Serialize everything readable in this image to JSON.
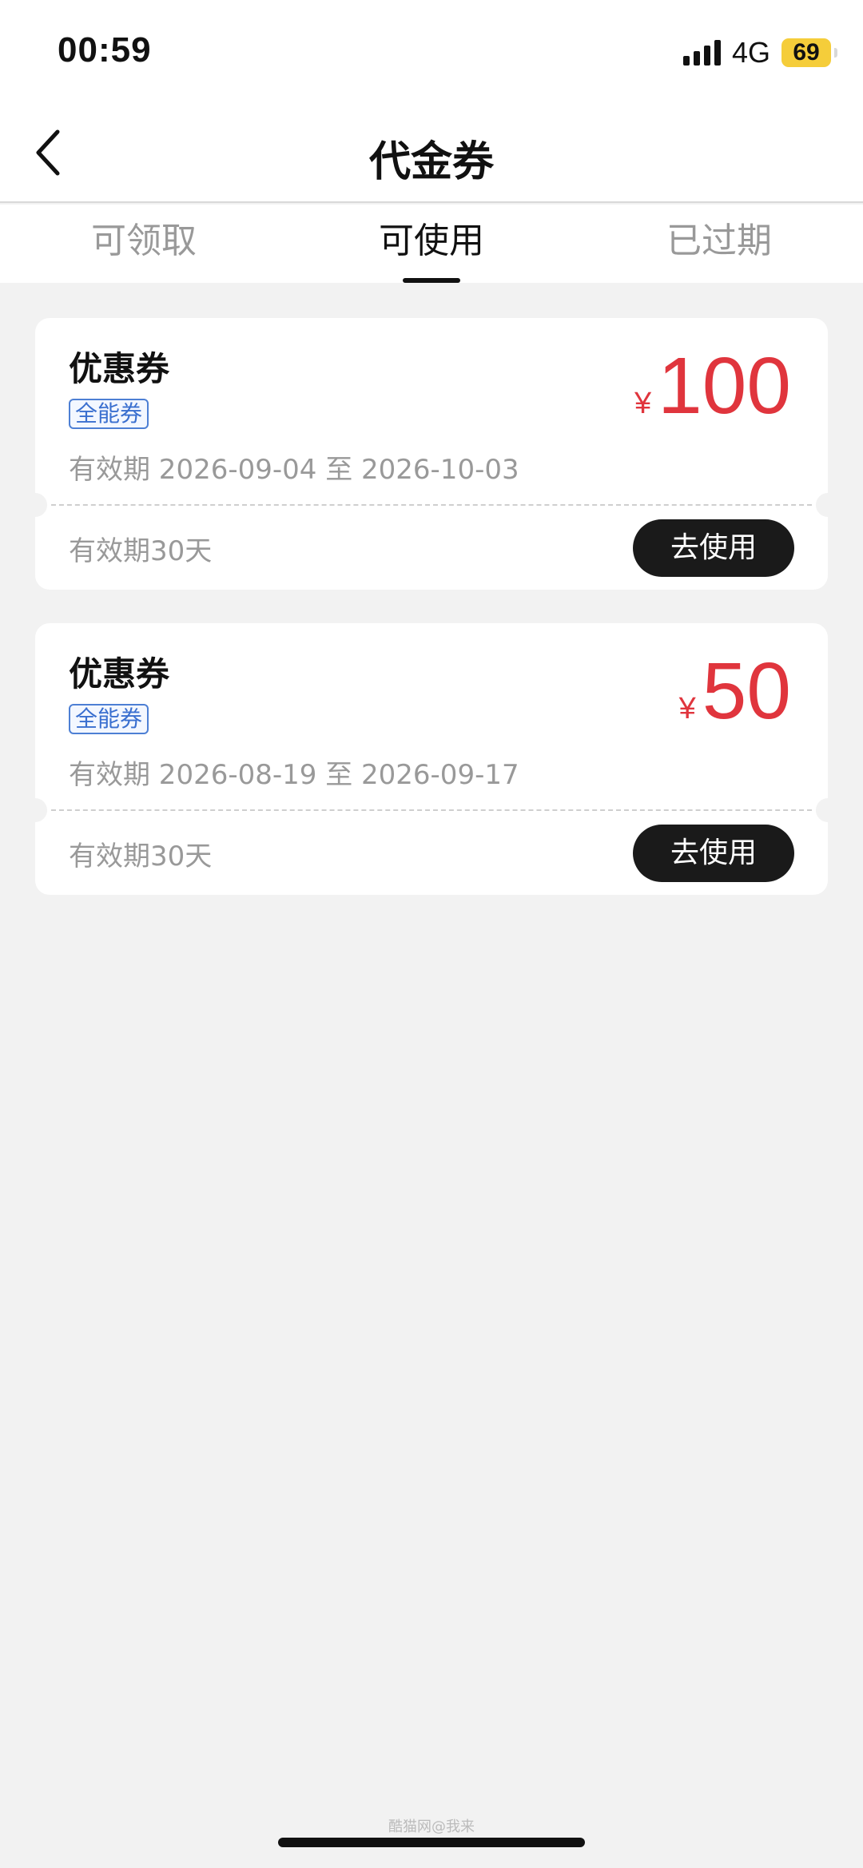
{
  "status_bar": {
    "time": "00:59",
    "network": "4G",
    "battery": "69",
    "signal_icon": "signal-bars-icon",
    "battery_color": "#f5cd3a"
  },
  "nav": {
    "title": "代金券",
    "back_icon": "chevron-left-icon"
  },
  "tabs": [
    {
      "label": "可领取",
      "active": false
    },
    {
      "label": "可使用",
      "active": true
    },
    {
      "label": "已过期",
      "active": false
    }
  ],
  "coupons": [
    {
      "title": "优惠券",
      "tag": "全能券",
      "currency": "¥",
      "amount": "100",
      "validity": "有效期 2026-09-04 至 2026-10-03",
      "duration": "有效期30天",
      "button": "去使用"
    },
    {
      "title": "优惠券",
      "tag": "全能券",
      "currency": "¥",
      "amount": "50",
      "validity": "有效期 2026-08-19 至 2026-09-17",
      "duration": "有效期30天",
      "button": "去使用"
    }
  ],
  "colors": {
    "accent_red": "#e0353d",
    "tag_blue": "#3a6fcf",
    "button_dark": "#1a1a1a",
    "background": "#f2f2f2"
  },
  "watermark": "酷猫网@我来"
}
